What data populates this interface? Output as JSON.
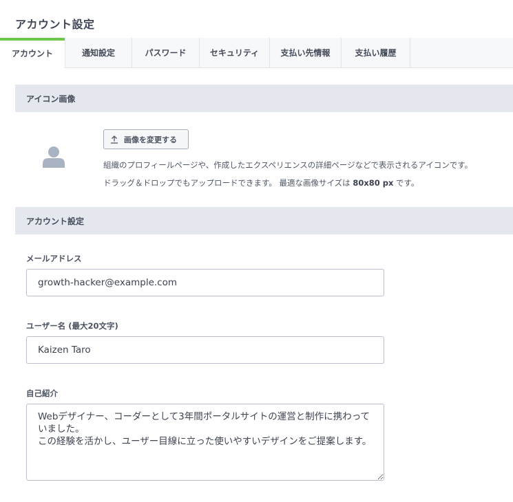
{
  "page": {
    "title": "アカウント設定"
  },
  "tabs": [
    {
      "label": "アカウント",
      "active": true
    },
    {
      "label": "通知設定",
      "active": false
    },
    {
      "label": "パスワード",
      "active": false
    },
    {
      "label": "セキュリティ",
      "active": false
    },
    {
      "label": "支払い先情報",
      "active": false
    },
    {
      "label": "支払い履歴",
      "active": false
    }
  ],
  "icon_section": {
    "title": "アイコン画像",
    "avatar_icon": "user-silhouette-icon",
    "upload_button_label": "画像を変更する",
    "upload_button_icon": "upload-icon",
    "description_line1": "組織のプロフィールページや、作成したエクスペリエンスの詳細ページなどで表示されるアイコンです。",
    "description_line2_prefix": "ドラッグ＆ドロップでもアップロードできます。 最適な画像サイズは ",
    "description_line2_size": "80x80 px",
    "description_line2_suffix": " です。"
  },
  "account_section": {
    "title": "アカウント設定",
    "email": {
      "label": "メールアドレス",
      "value": "growth-hacker@example.com"
    },
    "username": {
      "label": "ユーザー名 (最大20文字)",
      "value": "Kaizen Taro"
    },
    "bio": {
      "label": "自己紹介",
      "value": "Webデザイナー、コーダーとして3年間ポータルサイトの運営と制作に携わっていました。\nこの経験を活かし、ユーザー目線に立った使いやすいデザインをご提案します。"
    }
  },
  "colors": {
    "accent": "#6cc84a",
    "section_bg": "#e4e8ee",
    "tab_bg": "#f7f8fa",
    "avatar": "#aab3c2"
  }
}
